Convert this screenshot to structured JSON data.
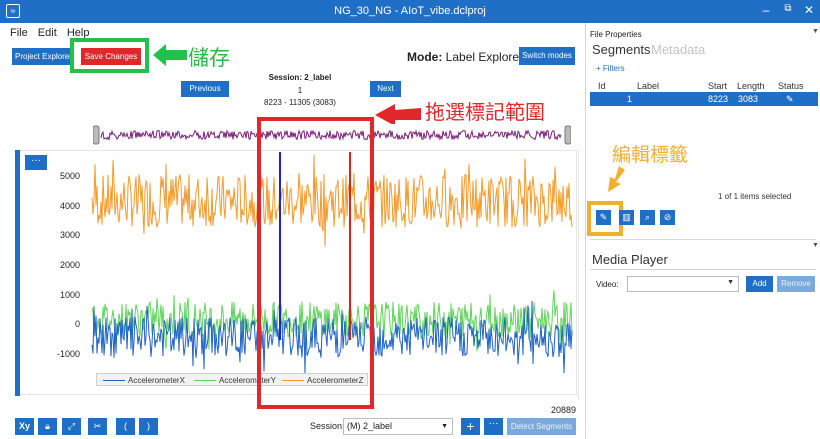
{
  "window": {
    "title": "NG_30_NG - AIoT_vibe.dclproj",
    "controls": [
      "minimize",
      "maximize",
      "close"
    ]
  },
  "menu": [
    "File",
    "Edit",
    "Help"
  ],
  "toolbar": {
    "project_explorer_label": "Project Explorer",
    "save_changes_label": "Save Changes",
    "mode_prefix": "Mode:",
    "mode_value": "Label Explorer",
    "switch_modes_label": "Switch modes"
  },
  "session_nav": {
    "title": "Session: 2_label",
    "index": "1",
    "range": "8223 - 11305 (3083)",
    "previous_label": "Previous",
    "next_label": "Next"
  },
  "annotations": {
    "save": "儲存",
    "drag_select": "拖選標記範圍",
    "edit_label": "編輯標籤"
  },
  "chart_data": {
    "type": "line",
    "y_ticks": [
      "5000",
      "4000",
      "3000",
      "2000",
      "1000",
      "0",
      "-1000"
    ],
    "ylim": [
      -1500,
      5800
    ],
    "series": [
      {
        "name": "AccelerometerX",
        "color": "#1f62c8",
        "center": -400,
        "amplitude": 700
      },
      {
        "name": "AccelerometerY",
        "color": "#5fd45a",
        "center": 200,
        "amplitude": 600
      },
      {
        "name": "AccelerometerZ",
        "color": "#f39a2b",
        "center": 4200,
        "amplitude": 900
      }
    ],
    "sample_count": "20889",
    "selection_lines": [
      {
        "color": "#2222cc"
      },
      {
        "color": "#e02020"
      }
    ]
  },
  "chart_controls": {
    "menu_label": "···"
  },
  "bottom_bar": {
    "tools": [
      "Xy",
      "lock",
      "expand",
      "cut",
      "(",
      ")"
    ],
    "session_label": "Session:",
    "session_value": "(M) 2_label",
    "add_label": "+",
    "more_label": "···",
    "detect_segments_label": "Detect Segments"
  },
  "right_panel": {
    "file_properties": "File Properties",
    "tabs": [
      "Segments",
      "Metadata"
    ],
    "filters_label": "+ Filters",
    "table": {
      "headers": [
        "Id",
        "Label",
        "Start",
        "Length",
        "Status"
      ],
      "rows": [
        {
          "id": "1",
          "label": "",
          "start": "8223",
          "length": "3083",
          "status": "✎"
        }
      ]
    },
    "items_selected": "1 of 1 items selected",
    "media_player_title": "Media Player",
    "video_label": "Video:",
    "add_label": "Add",
    "remove_label": "Remove"
  },
  "colors": {
    "accent": "#1f6fc6",
    "save": "#e0282b",
    "annotation_green": "#22c24a",
    "annotation_red": "#e0282b",
    "annotation_yellow": "#f0b030",
    "overview": "#7b1e7a"
  }
}
